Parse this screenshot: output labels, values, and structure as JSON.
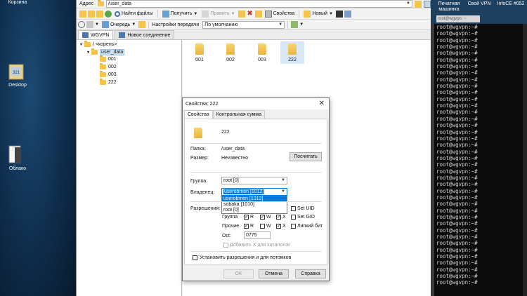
{
  "desktop": {
    "recycle_bin_label": "Корзина",
    "desktop_label": "Desktop",
    "cloud_label": "Облако"
  },
  "winscp": {
    "address_label": "Адрес",
    "address_value": "/user_data",
    "toolbar1": {
      "find_files": "Найти файлы",
      "get": "Получить",
      "edit": "Править",
      "properties": "Свойства",
      "new": "Новый"
    },
    "toolbar2": {
      "queue": "Очередь",
      "transfer_settings": "Настройки передачи",
      "transfer_value": "По умолчанию"
    },
    "tabs": [
      {
        "label": "WGVPN"
      },
      {
        "label": "Новое соединение"
      }
    ],
    "tree": [
      {
        "label": "/ <корень>"
      },
      {
        "label": "user_data"
      },
      {
        "label": "001"
      },
      {
        "label": "002"
      },
      {
        "label": "003"
      },
      {
        "label": "222"
      }
    ],
    "files": [
      {
        "name": "001"
      },
      {
        "name": "002"
      },
      {
        "name": "003"
      },
      {
        "name": "222"
      }
    ]
  },
  "dialog": {
    "title": "Свойства: 222",
    "tabs": [
      "Свойства",
      "Контрольная сумма"
    ],
    "file_name": "222",
    "folder_label": "Папка:",
    "folder_value": "/user_data",
    "size_label": "Размер:",
    "size_value": "Неизвестно",
    "calc_button": "Посчитать",
    "group_label": "Группа:",
    "group_value": "root [0]",
    "owner_label": "Владелец:",
    "owner_value": "userobmen [1012]",
    "owner_options": [
      "userobmen [1012]",
      "sobaka [1010]",
      "root [0]"
    ],
    "permissions_label": "Разрешения:",
    "perm_rows": [
      {
        "label": "Группа",
        "r": "R",
        "w": "W",
        "x": "X"
      },
      {
        "label": "Прочие",
        "r": "R",
        "w": "W",
        "x": "X"
      }
    ],
    "set_uid": "Set UID",
    "set_gid": "Set GID",
    "sticky": "Липкий бит",
    "octal_label": "Oct:",
    "octal_value": "0775",
    "add_x_label": "Добавить X для каталогов",
    "recursive_label": "Установить разрешения и для потомков",
    "ok_button": "OK",
    "cancel_button": "Отмена",
    "help_button": "Справка"
  },
  "terminal": {
    "top_items": [
      {
        "label": "Печатная машинка"
      },
      {
        "label": "Свой VPN"
      },
      {
        "label": "InfoCE #052"
      }
    ],
    "tab_title": "root@wgvpn: ~",
    "lines": [
      "root@wgvpn:~#",
      "root@wgvpn:~#",
      "root@wgvpn:~#",
      "root@wgvpn:~#",
      "root@wgvpn:~#",
      "root@wgvpn:~#",
      "root@wgvpn:~#",
      "root@wgvpn:~#",
      "root@wgvpn:~#",
      "root@wgvpn:~#",
      "root@wgvpn:~#",
      "root@wgvpn:~#",
      "root@wgvpn:~#",
      "root@wgvpn:~#",
      "root@wgvpn:~#",
      "root@wgvpn:~#",
      "root@wgvpn:~#",
      "root@wgvpn:~#",
      "root@wgvpn:~#",
      "root@wgvpn:~#",
      "root@wgvpn:~#",
      "root@wgvpn:~#",
      "root@wgvpn:~#",
      "root@wgvpn:~#",
      "root@wgvpn:~#",
      "root@wgvpn:~#",
      "root@wgvpn:~#",
      "root@wgvpn:~#",
      "root@wgvpn:~#",
      "root@wgvpn:~#",
      "root@wgvpn:~#",
      "root@wgvpn:~#",
      "root@wgvpn:~#",
      "root@wgvpn:~#",
      "root@wgvpn:~#",
      "root@wgvpn:~#",
      "root@wgvpn:~#",
      "root@wgvpn:~#",
      "root@wgvpn:~#",
      "root@wgvpn:~#"
    ]
  }
}
